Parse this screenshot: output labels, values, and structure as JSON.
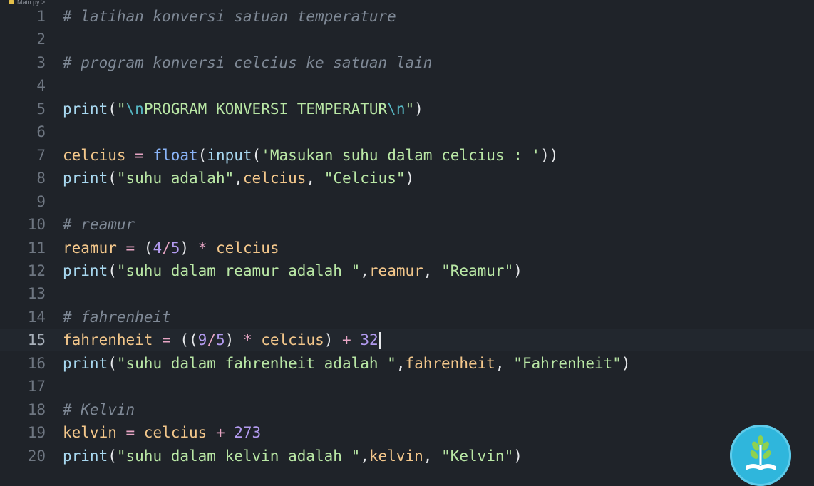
{
  "breadcrumb": {
    "file": "Main.py",
    "sep": " > ..."
  },
  "lines": [
    {
      "num": "1",
      "tokens": [
        {
          "t": "comment",
          "v": "# latihan konversi satuan temperature"
        }
      ]
    },
    {
      "num": "2",
      "tokens": []
    },
    {
      "num": "3",
      "tokens": [
        {
          "t": "comment",
          "v": "# program konversi celcius ke satuan lain"
        }
      ]
    },
    {
      "num": "4",
      "tokens": []
    },
    {
      "num": "5",
      "tokens": [
        {
          "t": "func",
          "v": "print"
        },
        {
          "t": "punct",
          "v": "("
        },
        {
          "t": "str",
          "v": "\""
        },
        {
          "t": "esc",
          "v": "\\n"
        },
        {
          "t": "str",
          "v": "PROGRAM KONVERSI TEMPERATUR"
        },
        {
          "t": "esc",
          "v": "\\n"
        },
        {
          "t": "str",
          "v": "\""
        },
        {
          "t": "punct",
          "v": ")"
        }
      ]
    },
    {
      "num": "6",
      "tokens": []
    },
    {
      "num": "7",
      "tokens": [
        {
          "t": "var",
          "v": "celcius"
        },
        {
          "t": "op",
          "v": " = "
        },
        {
          "t": "builtin",
          "v": "float"
        },
        {
          "t": "punct",
          "v": "("
        },
        {
          "t": "func",
          "v": "input"
        },
        {
          "t": "punct",
          "v": "("
        },
        {
          "t": "str",
          "v": "'Masukan suhu dalam celcius : '"
        },
        {
          "t": "punct",
          "v": "))"
        }
      ]
    },
    {
      "num": "8",
      "tokens": [
        {
          "t": "func",
          "v": "print"
        },
        {
          "t": "punct",
          "v": "("
        },
        {
          "t": "str",
          "v": "\"suhu adalah\""
        },
        {
          "t": "punct",
          "v": ","
        },
        {
          "t": "var",
          "v": "celcius"
        },
        {
          "t": "punct",
          "v": ", "
        },
        {
          "t": "str",
          "v": "\"Celcius\""
        },
        {
          "t": "punct",
          "v": ")"
        }
      ]
    },
    {
      "num": "9",
      "tokens": []
    },
    {
      "num": "10",
      "tokens": [
        {
          "t": "comment",
          "v": "# reamur"
        }
      ]
    },
    {
      "num": "11",
      "tokens": [
        {
          "t": "var",
          "v": "reamur"
        },
        {
          "t": "op",
          "v": " = "
        },
        {
          "t": "punct",
          "v": "("
        },
        {
          "t": "num",
          "v": "4"
        },
        {
          "t": "op",
          "v": "/"
        },
        {
          "t": "num",
          "v": "5"
        },
        {
          "t": "punct",
          "v": ")"
        },
        {
          "t": "op",
          "v": " * "
        },
        {
          "t": "var",
          "v": "celcius"
        }
      ]
    },
    {
      "num": "12",
      "tokens": [
        {
          "t": "func",
          "v": "print"
        },
        {
          "t": "punct",
          "v": "("
        },
        {
          "t": "str",
          "v": "\"suhu dalam reamur adalah \""
        },
        {
          "t": "punct",
          "v": ","
        },
        {
          "t": "var",
          "v": "reamur"
        },
        {
          "t": "punct",
          "v": ", "
        },
        {
          "t": "str",
          "v": "\"Reamur\""
        },
        {
          "t": "punct",
          "v": ")"
        }
      ]
    },
    {
      "num": "13",
      "tokens": []
    },
    {
      "num": "14",
      "tokens": [
        {
          "t": "comment",
          "v": "# fahrenheit"
        }
      ]
    },
    {
      "num": "15",
      "active": true,
      "cursor": true,
      "tokens": [
        {
          "t": "var",
          "v": "fahrenheit"
        },
        {
          "t": "op",
          "v": " = "
        },
        {
          "t": "punct",
          "v": "(("
        },
        {
          "t": "num",
          "v": "9"
        },
        {
          "t": "op",
          "v": "/"
        },
        {
          "t": "num",
          "v": "5"
        },
        {
          "t": "punct",
          "v": ")"
        },
        {
          "t": "op",
          "v": " * "
        },
        {
          "t": "var",
          "v": "celcius"
        },
        {
          "t": "punct",
          "v": ")"
        },
        {
          "t": "op",
          "v": " + "
        },
        {
          "t": "num",
          "v": "32"
        }
      ]
    },
    {
      "num": "16",
      "tokens": [
        {
          "t": "func",
          "v": "print"
        },
        {
          "t": "punct",
          "v": "("
        },
        {
          "t": "str",
          "v": "\"suhu dalam fahrenheit adalah \""
        },
        {
          "t": "punct",
          "v": ","
        },
        {
          "t": "var",
          "v": "fahrenheit"
        },
        {
          "t": "punct",
          "v": ", "
        },
        {
          "t": "str",
          "v": "\"Fahrenheit\""
        },
        {
          "t": "punct",
          "v": ")"
        }
      ]
    },
    {
      "num": "17",
      "tokens": []
    },
    {
      "num": "18",
      "tokens": [
        {
          "t": "comment",
          "v": "# Kelvin"
        }
      ]
    },
    {
      "num": "19",
      "tokens": [
        {
          "t": "var",
          "v": "kelvin"
        },
        {
          "t": "op",
          "v": " = "
        },
        {
          "t": "var",
          "v": "celcius"
        },
        {
          "t": "op",
          "v": " + "
        },
        {
          "t": "num",
          "v": "273"
        }
      ]
    },
    {
      "num": "20",
      "tokens": [
        {
          "t": "func",
          "v": "print"
        },
        {
          "t": "punct",
          "v": "("
        },
        {
          "t": "str",
          "v": "\"suhu dalam kelvin adalah \""
        },
        {
          "t": "punct",
          "v": ","
        },
        {
          "t": "var",
          "v": "kelvin"
        },
        {
          "t": "punct",
          "v": ", "
        },
        {
          "t": "str",
          "v": "\"Kelvin\""
        },
        {
          "t": "punct",
          "v": ")"
        }
      ]
    }
  ],
  "logo": {
    "icon": "plant-book-icon"
  }
}
